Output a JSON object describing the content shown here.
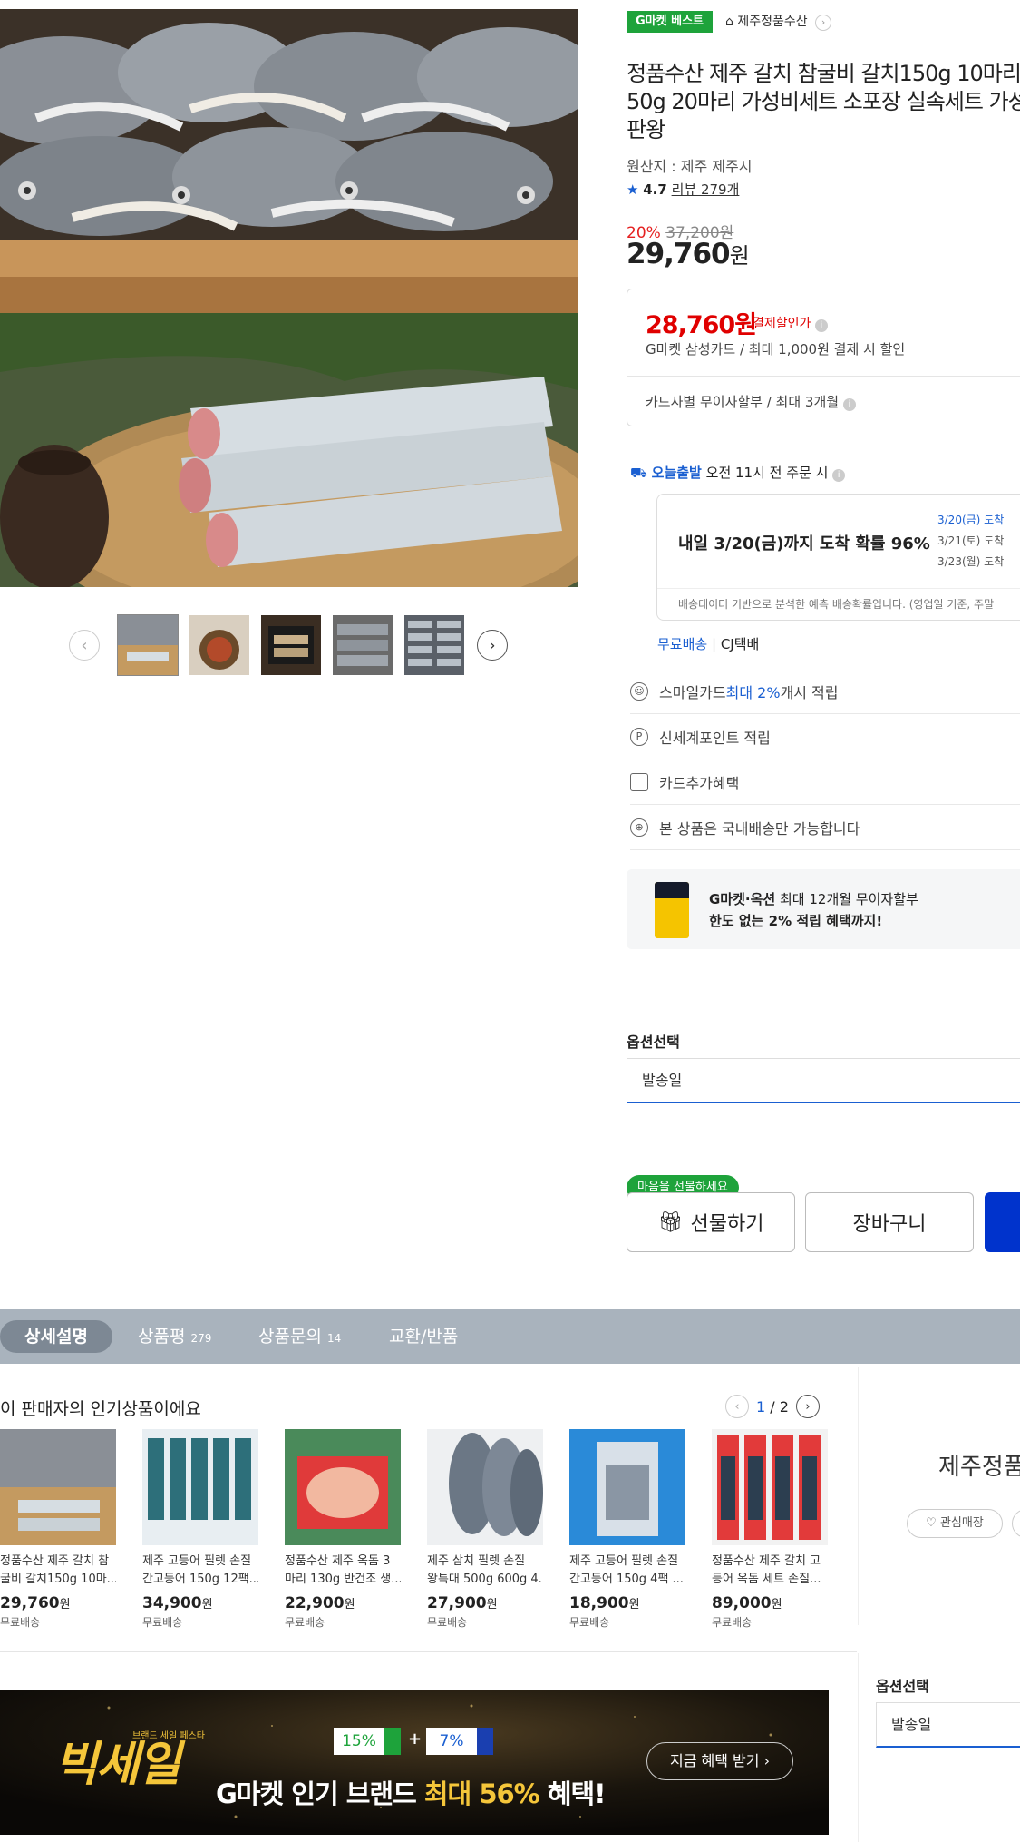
{
  "gallery": {
    "thumb_count": 5
  },
  "badge": {
    "best": "G마켓 베스트"
  },
  "store": {
    "link": "제주정품수산"
  },
  "product": {
    "title_line1": "정품수산 제주 갈치 참굴비 갈치150g 10마리",
    "title_line2": "50g 20마리 가성비세트 소포장 실속세트 가성",
    "title_line3": "판왕",
    "origin": "원산지 : 제주 제주시",
    "rating": "4.7",
    "review_label": "리뷰 279개",
    "discount_pct": "20%",
    "original_price": "37,200원",
    "price": "29,760",
    "price_unit": "원"
  },
  "card_benefit": {
    "pay_price": "28,760원",
    "pay_label": "결제할인가",
    "pay_desc": "G마켓 삼성카드 / 최대 1,000원 결제 시 할인",
    "installment": "카드사별 무이자할부 / 최대 3개월"
  },
  "delivery": {
    "today_badge": "오늘출발",
    "today_text": "오전 11시 전 주문 시",
    "main": "내일 3/20(금)까지 도착 확률 96%",
    "dates": [
      "3/20(금) 도착",
      "3/21(토) 도착",
      "3/23(월) 도착"
    ],
    "note": "배송데이터 기반으로 분석한 예측 배송확률입니다. (영업일 기준, 주말",
    "free": "무료배송",
    "carrier": "CJ택배"
  },
  "benefits": [
    {
      "pre": "스마일카드 ",
      "hl": "최대 2%",
      "post": " 캐시 적립",
      "icon": "smile-icon"
    },
    {
      "pre": "신세계포인트 적립",
      "hl": "",
      "post": "",
      "icon": "point-icon"
    },
    {
      "pre": "카드추가혜택",
      "hl": "",
      "post": "",
      "icon": "card-icon"
    },
    {
      "pre": "본 상품은 국내배송만 가능합니다",
      "hl": "",
      "post": "",
      "icon": "globe-icon"
    }
  ],
  "promo": {
    "line1_bold": "G마켓·옥션",
    "line1_rest": " 최대 12개월 무이자할부",
    "line2": "한도 없는 2% 적립 혜택까지!"
  },
  "option": {
    "label": "옵션선택",
    "value": "발송일"
  },
  "actions": {
    "gift_tag": "마음을 선물하세요",
    "gift": "선물하기",
    "cart": "장바구니"
  },
  "tabs": [
    {
      "label": "상세설명",
      "count": ""
    },
    {
      "label": "상품평",
      "count": "279"
    },
    {
      "label": "상품문의",
      "count": "14"
    },
    {
      "label": "교환/반품",
      "count": ""
    }
  ],
  "popular": {
    "title": "이 판매자의 인기상품이에요",
    "page_current": "1",
    "page_total": "/ 2",
    "items": [
      {
        "name1": "정품수산 제주 갈치 참",
        "name2": "굴비 갈치150g 10마...",
        "price": "29,760",
        "unit": "원",
        "ship": "무료배송"
      },
      {
        "name1": "제주 고등어 필렛 손질",
        "name2": "간고등어 150g 12팩...",
        "price": "34,900",
        "unit": "원",
        "ship": "무료배송"
      },
      {
        "name1": "정품수산 제주 옥돔 3",
        "name2": "마리 130g 반건조 생...",
        "price": "22,900",
        "unit": "원",
        "ship": "무료배송"
      },
      {
        "name1": "제주 삼치 필렛 손질",
        "name2": "왕특대 500g 600g 4...",
        "price": "27,900",
        "unit": "원",
        "ship": "무료배송"
      },
      {
        "name1": "제주 고등어 필렛 손질",
        "name2": "간고등어 150g 4팩 ...",
        "price": "18,900",
        "unit": "원",
        "ship": "무료배송"
      },
      {
        "name1": "정품수산 제주 갈치 고",
        "name2": "등어 옥돔 세트 손질...",
        "price": "89,000",
        "unit": "원",
        "ship": "무료배송"
      }
    ]
  },
  "seller": {
    "name": "제주정품",
    "fav": "관심매장"
  },
  "banner": {
    "logo": "빅세일",
    "logo_sub": "브랜드 세일 페스타",
    "pct1": "15%",
    "plus": "+",
    "pct2": "7%",
    "headline_pre": "G마켓 인기 브랜드 ",
    "headline_hl": "최대 56%",
    "headline_post": " 혜택!",
    "cta": "지금 혜택 받기 ›"
  },
  "option2": {
    "label": "옵션선택",
    "value": "발송일"
  }
}
